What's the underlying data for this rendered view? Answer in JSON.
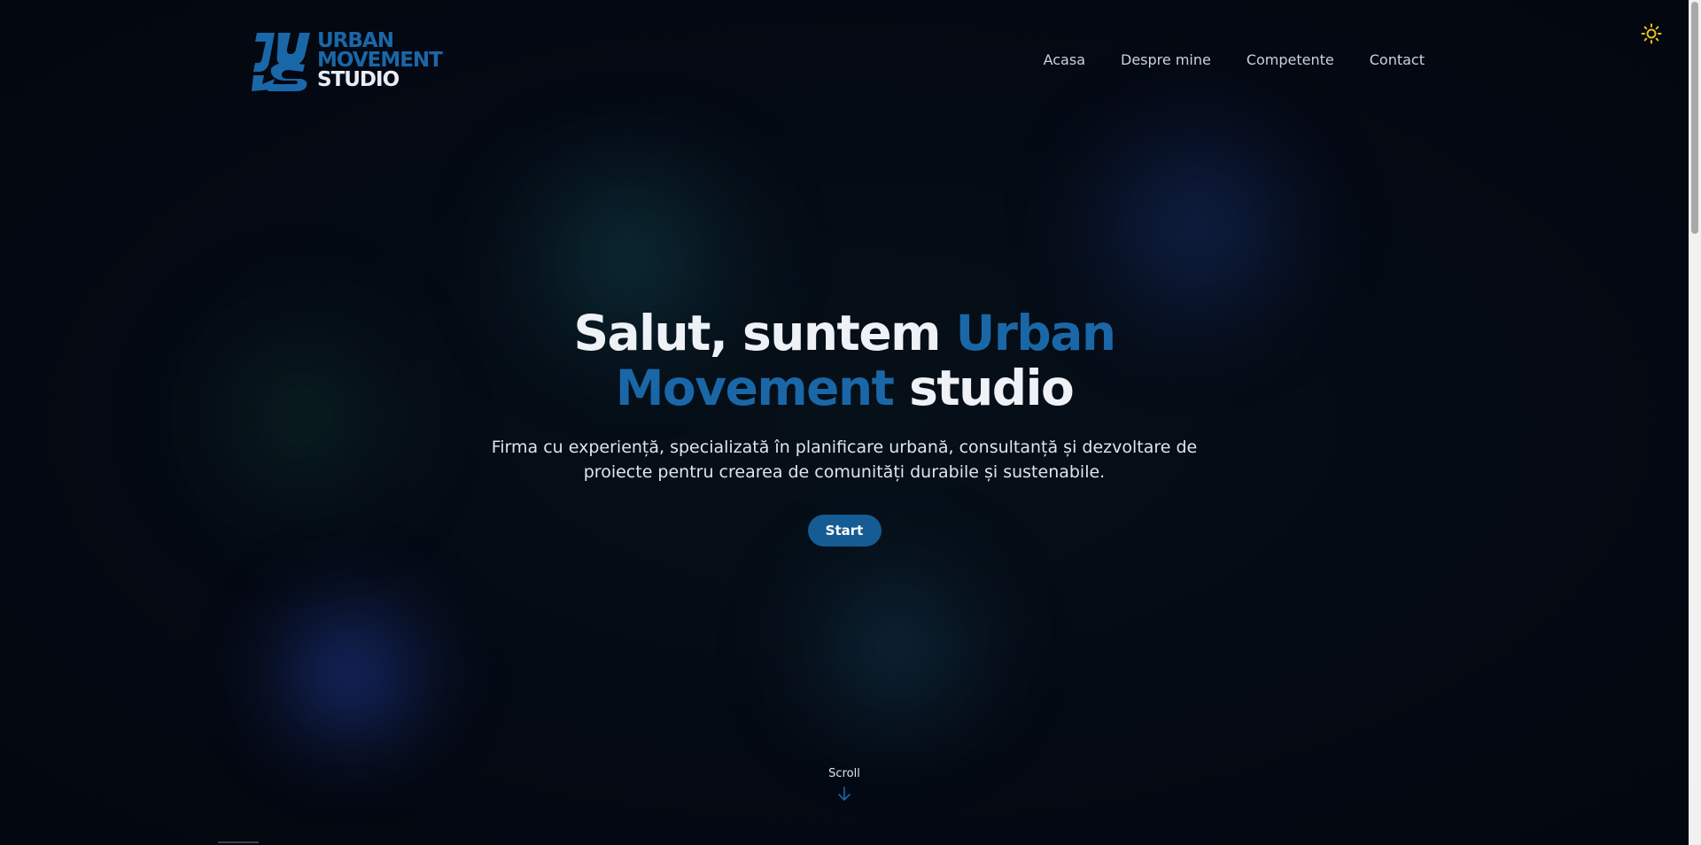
{
  "brand": {
    "logo_line_1": "URBAN",
    "logo_line_2": "MOVEMENT",
    "logo_line_3": "STUDIO",
    "logo_icon": "ums-logo-mark",
    "accent_color": "#1a67a8"
  },
  "nav": {
    "items": [
      {
        "label": "Acasa"
      },
      {
        "label": "Despre mine"
      },
      {
        "label": "Competente"
      },
      {
        "label": "Contact"
      }
    ],
    "theme_toggle_icon": "sun-icon",
    "theme_toggle_color": "#e8c21a"
  },
  "hero": {
    "title_part_1": "Salut, suntem ",
    "title_accent_1": "Urban",
    "title_accent_2": "Movement",
    "title_part_2": " studio",
    "subtitle": "Firma cu experiență, specializată în planificare urbană, consultanță și dezvoltare de proiecte pentru crearea de comunități durabile și sustenabile.",
    "cta_label": "Start",
    "cta_color": "#155c94"
  },
  "scroll": {
    "label": "Scroll",
    "icon": "arrow-down-icon"
  },
  "colors": {
    "background": "#050a14",
    "text": "#eef2f7"
  }
}
